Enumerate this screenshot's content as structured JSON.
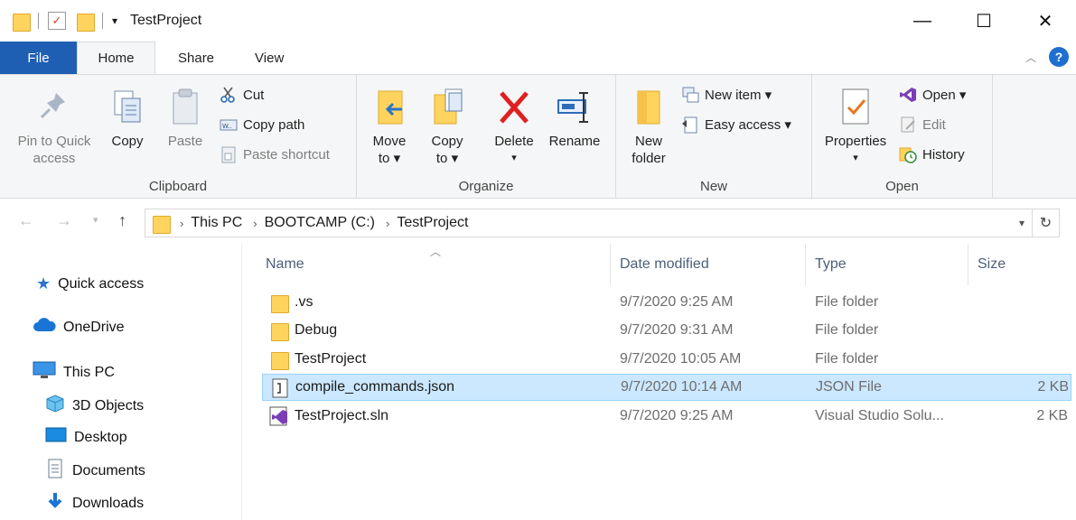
{
  "window": {
    "title": "TestProject",
    "controls": {
      "minimize": "—",
      "maximize": "☐",
      "close": "✕"
    }
  },
  "ribbon_tabs": [
    "File",
    "Home",
    "Share",
    "View"
  ],
  "clipboard": {
    "pin_line1": "Pin to Quick",
    "pin_line2": "access",
    "copy": "Copy",
    "paste": "Paste",
    "cut": "Cut",
    "copy_path": "Copy path",
    "paste_shortcut": "Paste shortcut",
    "label": "Clipboard"
  },
  "organize": {
    "move_line1": "Move",
    "move_line2": "to ▾",
    "copy_line1": "Copy",
    "copy_line2": "to ▾",
    "delete": "Delete",
    "rename": "Rename",
    "label": "Organize"
  },
  "new_group": {
    "new_folder_line1": "New",
    "new_folder_line2": "folder",
    "new_item": "New item ▾",
    "easy_access": "Easy access ▾",
    "label": "New"
  },
  "open_group": {
    "properties": "Properties",
    "open": "Open ▾",
    "edit": "Edit",
    "history": "History",
    "label": "Open"
  },
  "address": {
    "crumbs": [
      "This PC",
      "BOOTCAMP (C:)",
      "TestProject"
    ]
  },
  "nav_pane": {
    "items": [
      "Quick access",
      "OneDrive",
      "This PC",
      "3D Objects",
      "Desktop",
      "Documents",
      "Downloads"
    ]
  },
  "columns": [
    "Name",
    "Date modified",
    "Type",
    "Size"
  ],
  "files": [
    {
      "name": ".vs",
      "date": "9/7/2020 9:25 AM",
      "type": "File folder",
      "size": ""
    },
    {
      "name": "Debug",
      "date": "9/7/2020 9:31 AM",
      "type": "File folder",
      "size": ""
    },
    {
      "name": "TestProject",
      "date": "9/7/2020 10:05 AM",
      "type": "File folder",
      "size": ""
    },
    {
      "name": "compile_commands.json",
      "date": "9/7/2020 10:14 AM",
      "type": "JSON File",
      "size": "2 KB"
    },
    {
      "name": "TestProject.sln",
      "date": "9/7/2020 9:25 AM",
      "type": "Visual Studio Solu...",
      "size": "2 KB"
    }
  ],
  "colors": {
    "accent": "#1e5fb4",
    "selection": "#cce8ff",
    "folder": "#ffd45e"
  }
}
